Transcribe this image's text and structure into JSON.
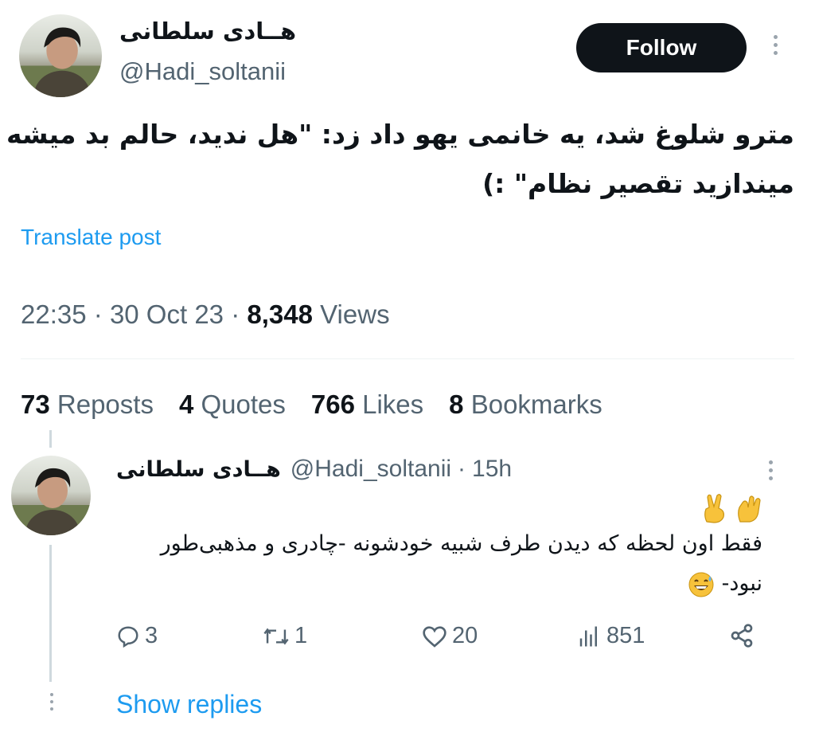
{
  "tweet": {
    "author": {
      "display_name": "هــادی سلطانی",
      "handle": "@Hadi_soltanii",
      "avatar_icon": "user-avatar"
    },
    "follow_label": "Follow",
    "text_lines": [
      "مترو شلوغ شد، یه خانمی یهو داد زد: \"هل ندید، حالم بد میشه",
      "میندازید تقصیر نظام\" :)"
    ],
    "translate_label": "Translate post",
    "time": "22:35",
    "date": "30 Oct 23",
    "views_count": "8,348",
    "views_label": "Views",
    "separator": "·",
    "stats": {
      "reposts": {
        "count": "73",
        "label": "Reposts"
      },
      "quotes": {
        "count": "4",
        "label": "Quotes"
      },
      "likes": {
        "count": "766",
        "label": "Likes"
      },
      "bookmarks": {
        "count": "8",
        "label": "Bookmarks"
      }
    }
  },
  "reply": {
    "display_name": "هــادی سلطانی",
    "handle": "@Hadi_soltanii",
    "time_ago": "15h",
    "text_lines": [
      "فقط اون لحظه که دیدن طرف شبیه خودشونه -چادری و مذهبی‌طور",
      "نبود-"
    ],
    "emojis": [
      "ok-hand",
      "victory-hand",
      "grinning-sweat-face"
    ],
    "actions": {
      "replies": "3",
      "reposts": "1",
      "likes": "20",
      "views": "851"
    },
    "show_replies_label": "Show replies"
  },
  "colors": {
    "text": "#0f1419",
    "secondary": "#536471",
    "link": "#1d9bf0",
    "follow_bg": "#0f1419",
    "divider": "#eff3f4"
  }
}
